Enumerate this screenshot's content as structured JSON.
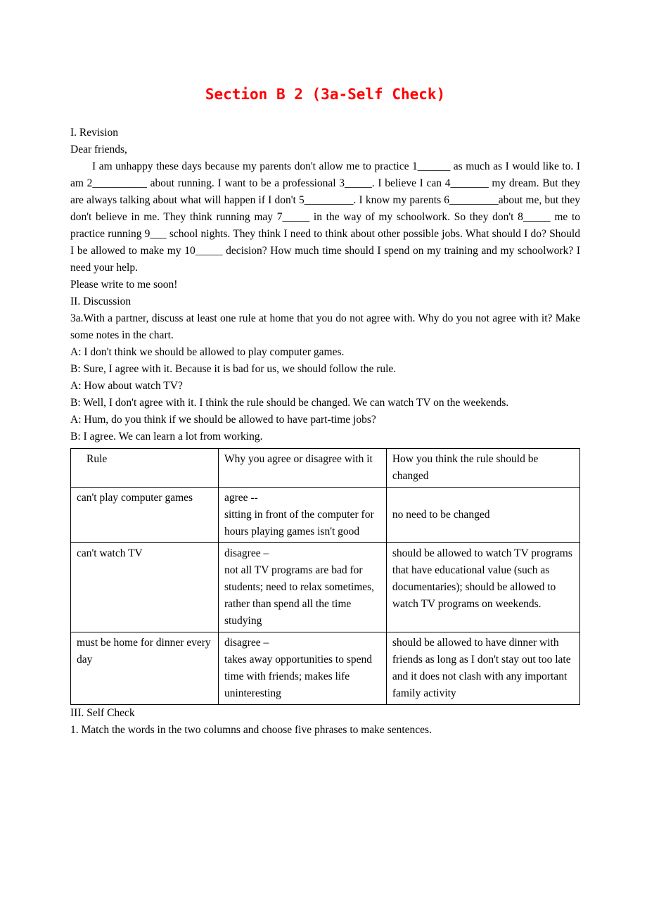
{
  "title": "Section B 2 (3a-Self Check)",
  "section1": {
    "heading": "I. Revision",
    "greeting": "Dear friends,",
    "body": "I am unhappy these days because my parents don't allow me to practice 1______ as much as I would like to. I am 2__________ about running. I want to be a professional 3_____. I believe I can 4_______ my dream. But they are always talking about what will happen if I don't 5_________. I know my parents 6_________about me, but they don't believe in me. They think running may 7_____ in the way of my schoolwork. So they don't 8_____ me to practice running 9___ school nights. They think I need to think about other possible jobs. What should I do? Should I be allowed to make my 10_____ decision? How much time should I spend on my training and my schoolwork? I need your help.",
    "closing": "Please write to me soon!"
  },
  "section2": {
    "heading": "II. Discussion",
    "prompt": "3a.With a partner, discuss at least one rule at home that you do not agree with. Why do you not agree with it? Make some notes in the chart.",
    "dialog": [
      "A: I don't think we should be allowed to play computer games.",
      "B: Sure, I agree with it. Because it is bad for us, we should follow the rule.",
      "A: How about watch TV?",
      "B: Well, I don't agree with it. I think the rule should be changed. We can watch TV on the weekends.",
      "A: Hum, do you think if we should be allowed to have part-time jobs?",
      "B: I agree. We can learn a lot from working."
    ],
    "table": {
      "headers": [
        "Rule",
        "Why you agree or disagree with it",
        "How you think the rule should be changed"
      ],
      "rows": [
        {
          "rule": "can't play computer games",
          "why": "agree --\nsitting in front of the computer for hours playing games isn't good",
          "how": "no need to be changed"
        },
        {
          "rule": "can't watch TV",
          "why": "disagree –\nnot all TV programs are bad for students; need to relax sometimes, rather than spend all the time studying",
          "how": "should be allowed to watch TV programs that have educational value (such as documentaries); should be allowed to watch TV programs on weekends."
        },
        {
          "rule": "must be home for dinner every day",
          "why": "disagree –\ntakes away opportunities to spend time with friends; makes life uninteresting",
          "how": "should be allowed to have dinner with friends as long as I don't stay out too late and it does not clash with any important family activity"
        }
      ]
    }
  },
  "section3": {
    "heading": "III. Self Check",
    "item1": "1. Match the words in the two columns and choose five phrases to make sentences."
  }
}
